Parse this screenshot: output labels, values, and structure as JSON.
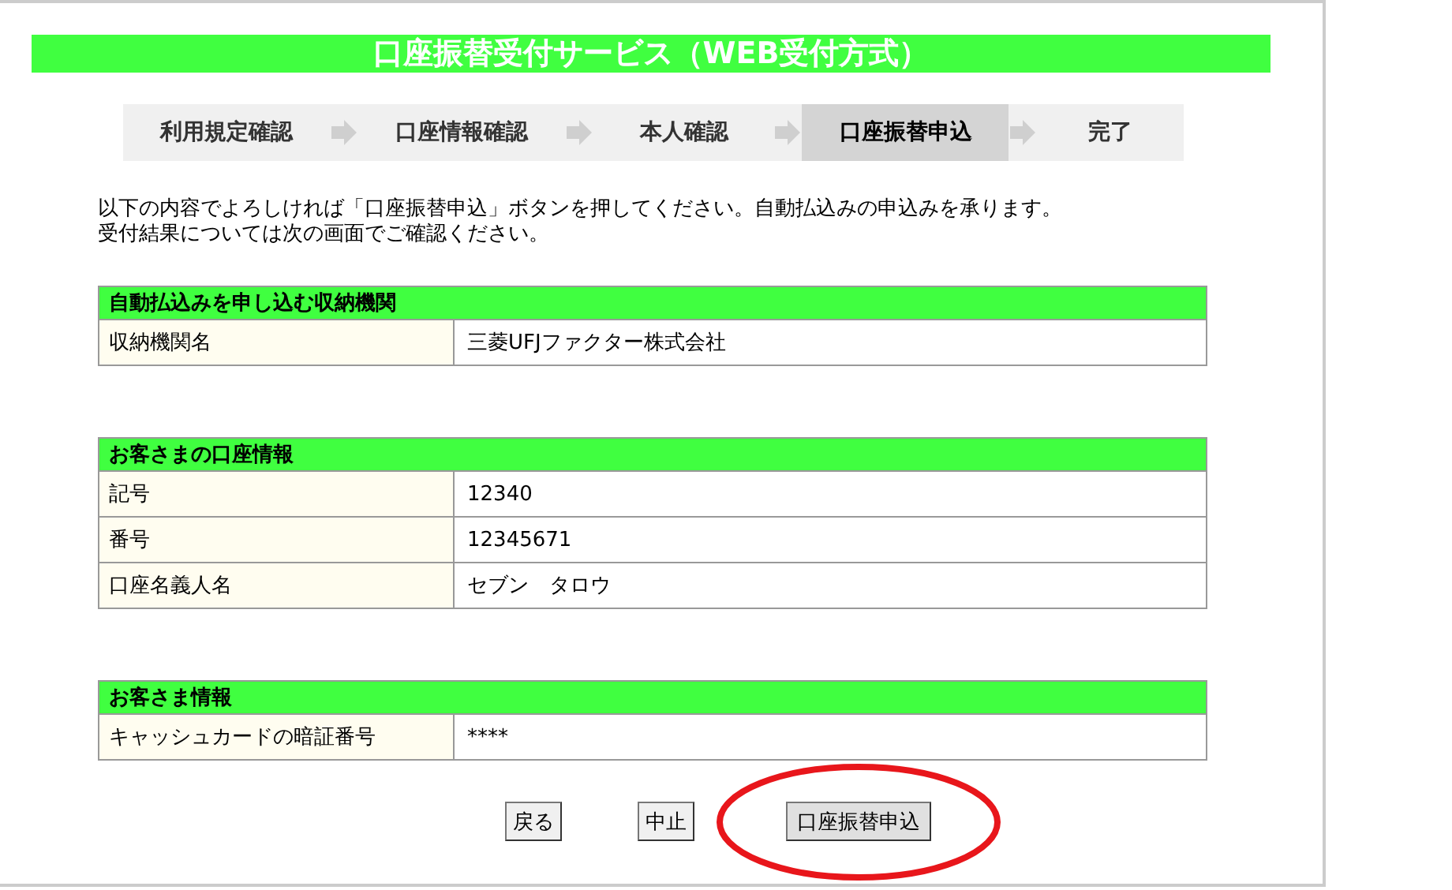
{
  "title": "口座振替受付サービス（WEB受付方式）",
  "steps": [
    {
      "label": "利用規定確認",
      "selected": false
    },
    {
      "label": "口座情報確認",
      "selected": false
    },
    {
      "label": "本人確認",
      "selected": false
    },
    {
      "label": "口座振替申込",
      "selected": true
    },
    {
      "label": "完了",
      "selected": false
    }
  ],
  "intro": [
    "以下の内容でよろしければ「口座振替申込」ボタンを押してください。自動払込みの申込みを承ります。",
    "受付結果については次の画面でご確認ください。"
  ],
  "sections": [
    {
      "heading": "自動払込みを申し込む収納機関",
      "rows": [
        {
          "label": "収納機関名",
          "value": "三菱UFJファクター株式会社"
        }
      ]
    },
    {
      "heading": "お客さまの口座情報",
      "rows": [
        {
          "label": "記号",
          "value": "12340"
        },
        {
          "label": "番号",
          "value": "12345671"
        },
        {
          "label": "口座名義人名",
          "value": "セブン　タロウ"
        }
      ]
    },
    {
      "heading": "お客さま情報",
      "rows": [
        {
          "label": "キャッシュカードの暗証番号",
          "value": "****"
        }
      ]
    }
  ],
  "buttons": [
    {
      "label": "戻る",
      "circled": false
    },
    {
      "label": "中止",
      "circled": false
    },
    {
      "label": "口座振替申込",
      "circled": true
    }
  ]
}
